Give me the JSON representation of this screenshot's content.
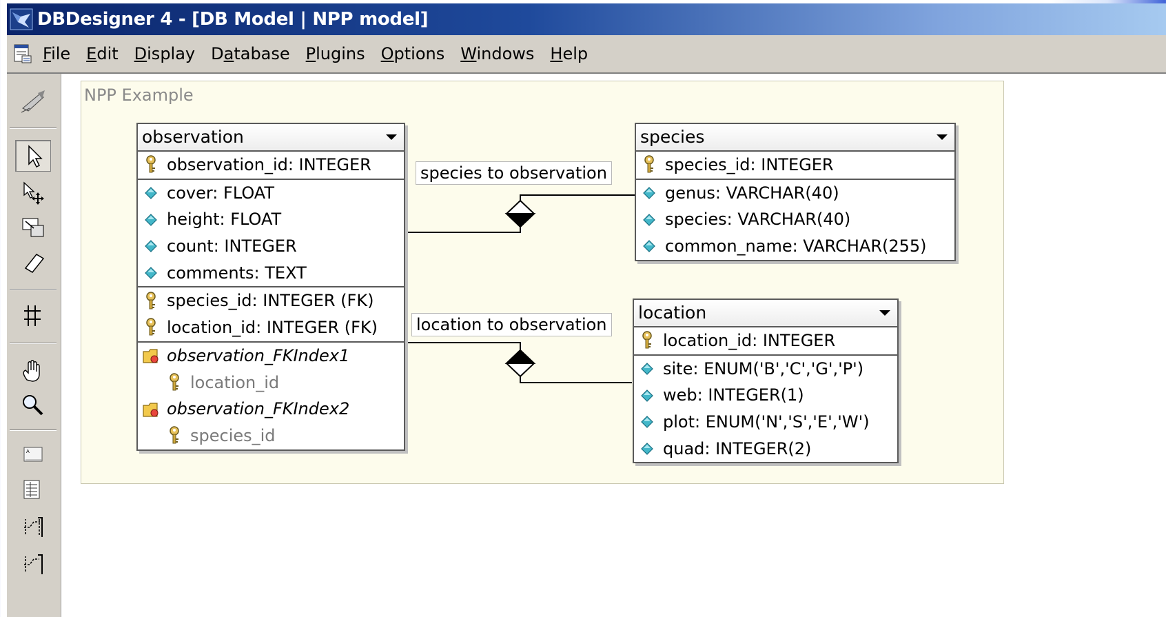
{
  "window": {
    "title": "DBDesigner 4 - [DB Model | NPP model]"
  },
  "menu": [
    {
      "pre": "",
      "key": "F",
      "post": "ile"
    },
    {
      "pre": "",
      "key": "E",
      "post": "dit"
    },
    {
      "pre": "",
      "key": "D",
      "post": "isplay"
    },
    {
      "pre": "D",
      "key": "a",
      "post": "tabase"
    },
    {
      "pre": "",
      "key": "P",
      "post": "lugins"
    },
    {
      "pre": "",
      "key": "O",
      "post": "ptions"
    },
    {
      "pre": "",
      "key": "W",
      "post": "indows"
    },
    {
      "pre": "",
      "key": "H",
      "post": "elp"
    }
  ],
  "toolbar": [
    {
      "icon": "design-mode-icon"
    },
    {
      "icon": "pointer-icon",
      "active": true
    },
    {
      "icon": "move-icon"
    },
    {
      "icon": "resize-icon"
    },
    {
      "icon": "eraser-icon"
    },
    {
      "icon": "region-grid-icon"
    },
    {
      "icon": "hand-icon"
    },
    {
      "icon": "zoom-icon"
    },
    {
      "icon": "note-icon"
    },
    {
      "icon": "image-icon"
    },
    {
      "icon": "relation-1n-icon"
    },
    {
      "icon": "relation-11-icon"
    }
  ],
  "region": {
    "title": "NPP Example"
  },
  "tables": {
    "observation": {
      "name": "observation",
      "pk": [
        "observation_id: INTEGER"
      ],
      "cols": [
        "cover: FLOAT",
        "height: FLOAT",
        "count: INTEGER",
        "comments: TEXT"
      ],
      "fks": [
        "species_id: INTEGER (FK)",
        "location_id: INTEGER (FK)"
      ],
      "indexes": [
        {
          "name": "observation_FKIndex1",
          "col": "location_id"
        },
        {
          "name": "observation_FKIndex2",
          "col": "species_id"
        }
      ]
    },
    "species": {
      "name": "species",
      "pk": [
        "species_id: INTEGER"
      ],
      "cols": [
        "genus: VARCHAR(40)",
        "species: VARCHAR(40)",
        "common_name: VARCHAR(255)"
      ]
    },
    "location": {
      "name": "location",
      "pk": [
        "location_id: INTEGER"
      ],
      "cols": [
        "site: ENUM('B','C','G','P')",
        "web: INTEGER(1)",
        "plot: ENUM('N','S','E','W')",
        "quad: INTEGER(2)"
      ]
    }
  },
  "relations": {
    "species_obs": "species to observation",
    "location_obs": "location to observation"
  }
}
